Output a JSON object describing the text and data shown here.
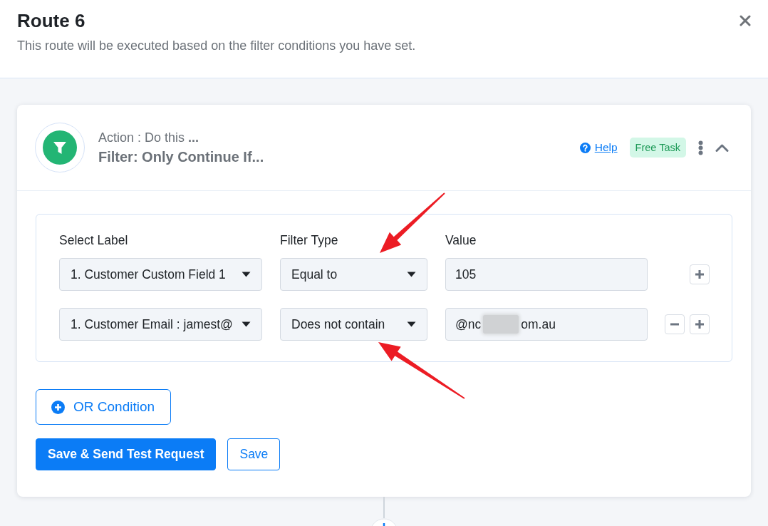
{
  "header": {
    "title": "Route 6",
    "subtitle": "This route will be executed based on the filter conditions you have set."
  },
  "step": {
    "caption": "Action : Do this **...**",
    "title": "**Filter:** Only Continue If...",
    "help_link": "Help",
    "badge": "Free Task",
    "expanded": true
  },
  "filter": {
    "columns": [
      "Select Label",
      "Filter Type",
      "Value"
    ],
    "conditions": [
      {
        "label": "1. Customer Custom Field 1",
        "filter_type": "Equal to",
        "value": "105",
        "blurred": false,
        "removable": false,
        "arrow_above": true,
        "arrow_below": false
      },
      {
        "label": "1. Customer Email : jamest@",
        "filter_type": "Does not contain",
        "value": "@nc",
        "blurred": true,
        "value_after_blur": "om.au",
        "removable": true,
        "arrow_above": false,
        "arrow_below": true
      }
    ]
  },
  "or_condition_button": "OR Condition",
  "buttons": [
    {
      "label": "Save & Send Test Request",
      "kind": "primary"
    },
    {
      "label": "Save",
      "kind": "outline"
    }
  ]
}
